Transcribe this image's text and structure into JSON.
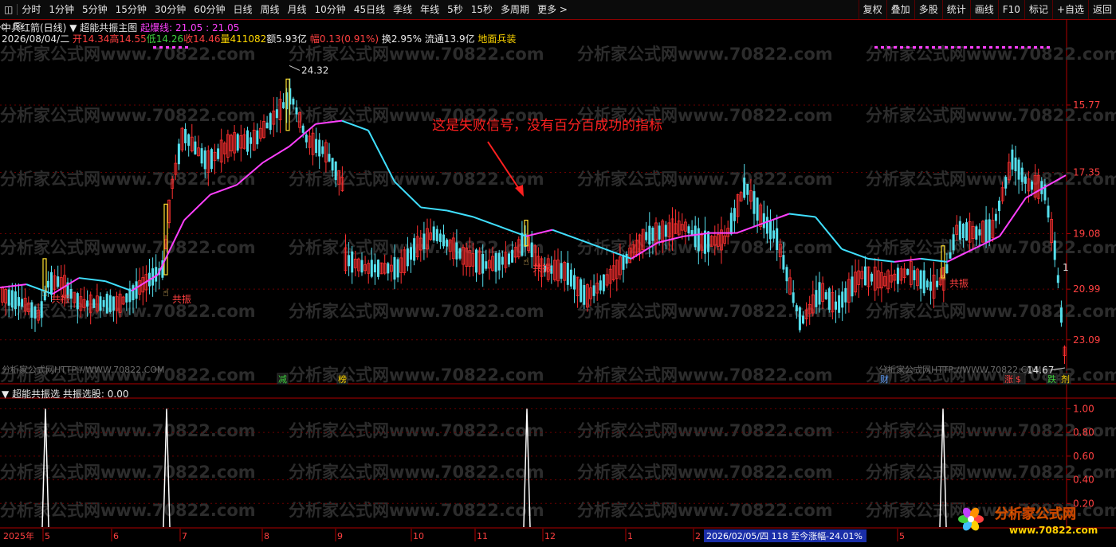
{
  "toolbar": {
    "left_items": [
      "分时",
      "1分钟",
      "5分钟",
      "15分钟",
      "30分钟",
      "60分钟",
      "日线",
      "周线",
      "月线",
      "10分钟",
      "45日线",
      "季线",
      "年线",
      "5秒",
      "15秒",
      "多周期",
      "更多"
    ],
    "right_items": [
      "复权",
      "叠加",
      "多股",
      "统计",
      "画线",
      "F10",
      "标记",
      "+自选",
      "返回"
    ]
  },
  "header": {
    "stock": "中兵红箭(日线)",
    "indicator": "超能共振主图",
    "line_label": "起爆线: 21.05 : 21.05",
    "date": "2026/08/04/二",
    "open": "开14.34",
    "high": "高14.55",
    "low": "低14.26",
    "close": "收14.46",
    "volume": "量411082",
    "amount": "额5.93亿",
    "change": "幅0.13(0.91%)",
    "turnover": "换2.95%",
    "float": "流通13.9亿",
    "sector": "地面兵装"
  },
  "watermarks": {
    "main": "分析家公式网www.70822.com",
    "url_main": "分析家公式网HTTP://WWW.70822.COM",
    "url_right": "分析家公式网HTTP://WWW.70822.COM",
    "logo_text": "分析家公式网",
    "logo_url": "www.70822.com"
  },
  "annotation": {
    "text": "这是失败信号，没有百分百成功的指标"
  },
  "main_chart": {
    "price_ticks": [
      "23.09",
      "20.99",
      "19.08",
      "17.35",
      "15.77"
    ],
    "high_marker": "24.32",
    "low_marker": "14.67",
    "signal_label": "共振",
    "event_marks": [
      {
        "text": "减",
        "color": "#3fd03f"
      },
      {
        "text": "榜",
        "color": "#ffd700"
      },
      {
        "text": "财",
        "color": "#60a0ff"
      },
      {
        "text": "涨",
        "color": "#ff4040"
      },
      {
        "text": "$",
        "color": "#ff4040"
      },
      {
        "text": "跌",
        "color": "#3fd03f"
      },
      {
        "text": "剂",
        "color": "#ffd700"
      }
    ],
    "right_tag": "1"
  },
  "chart_data": {
    "type": "candlestick",
    "title": "中兵红箭(日线) 超能共振主图",
    "ylim": [
      14.4,
      25.0
    ],
    "y_ticks": [
      15.77,
      17.35,
      19.08,
      20.99,
      23.09
    ],
    "x_labels": [
      "2025年",
      "5",
      "6",
      "7",
      "8",
      "9",
      "10",
      "11",
      "12",
      "1",
      "2",
      "3",
      "5"
    ],
    "high": 24.32,
    "low": 14.67,
    "series": [
      {
        "name": "起爆线",
        "color_up": "#ff40ff",
        "color_down": "#40e0ff",
        "values": [
          17.5,
          17.6,
          17.7,
          17.4,
          17.6,
          18.0,
          18.1,
          17.9,
          17.7,
          17.5,
          17.6,
          18.4,
          19.6,
          20.6,
          21.2,
          21.7,
          22.1,
          22.7,
          22.5,
          21.9,
          20.2,
          19.8,
          19.7,
          19.5,
          19.2,
          19.3,
          18.9,
          18.7,
          19.2,
          19.4,
          19.6,
          19.9,
          19.9,
          20.2,
          20.0,
          19.3,
          18.7,
          18.8,
          18.6,
          18.9,
          19.5
        ]
      }
    ],
    "signals": [
      {
        "x": "5",
        "value": 1.0,
        "label": "共振"
      },
      {
        "x": "7",
        "value": 1.0,
        "label": "共振"
      },
      {
        "x": "11",
        "value": 1.0,
        "label": "共振"
      },
      {
        "x": "5(2026)",
        "value": 1.0,
        "label": "共振"
      }
    ]
  },
  "sub_chart": {
    "title": "超能共振选",
    "label": "共振选股: 0.00",
    "ticks": [
      "1.00",
      "0.80",
      "0.60",
      "0.40",
      "0.20"
    ],
    "ylim": [
      0,
      1.05
    ]
  },
  "footer": {
    "year_label": "2025年",
    "months": [
      "5",
      "6",
      "7",
      "8",
      "9",
      "10",
      "11",
      "12",
      "1",
      "2",
      "5"
    ],
    "status": "2026/02/05/四 118 至今涨幅-24.01%"
  }
}
